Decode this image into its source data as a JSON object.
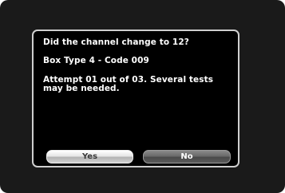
{
  "dialog": {
    "question": "Did the channel change to 12?",
    "box_info": "Box Type 4 - Code 009",
    "attempt_text": "Attempt 01 out of 03. Several tests may be needed.",
    "buttons": {
      "yes_label": "Yes",
      "no_label": "No"
    },
    "selected_button": "Yes"
  },
  "colors": {
    "screen_background": "#1a1a1a",
    "dialog_background": "#000000",
    "dialog_border": "#cfcfcf",
    "text": "#ffffff",
    "selected_button": "#e6e6e6",
    "unselected_button": "#5a5a5a"
  }
}
